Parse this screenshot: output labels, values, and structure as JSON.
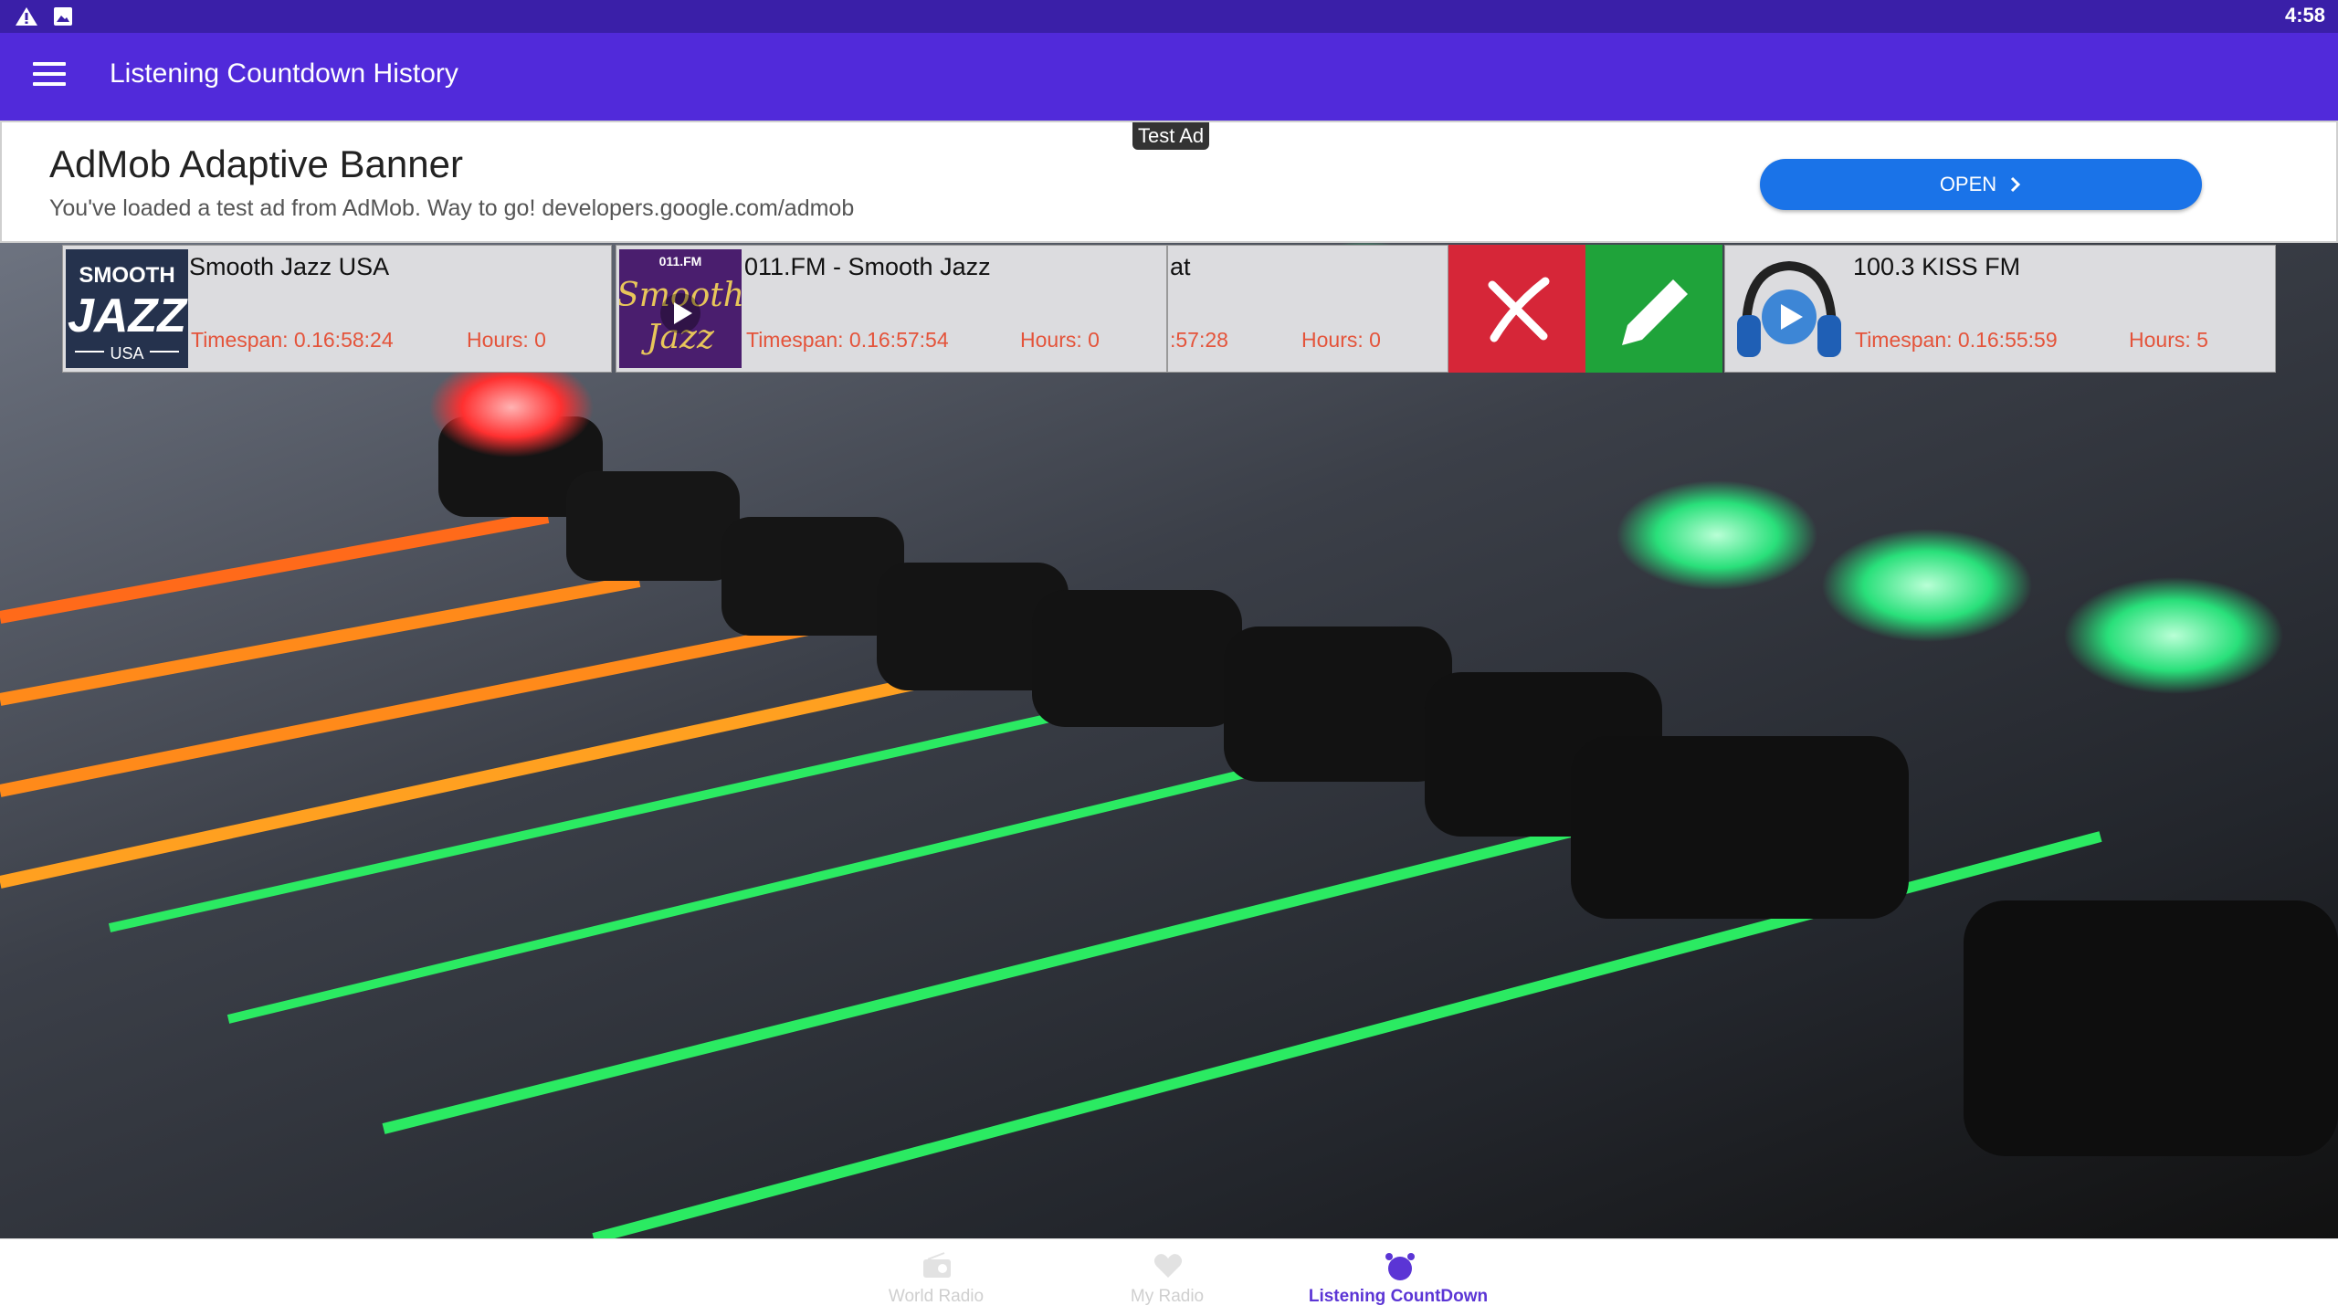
{
  "status": {
    "time": "4:58"
  },
  "appbar": {
    "title": "Listening Countdown History"
  },
  "ad": {
    "badge": "Test Ad",
    "headline": "AdMob Adaptive Banner",
    "body": "You've loaded a test ad from AdMob. Way to go! developers.google.com/admob",
    "cta": "OPEN"
  },
  "cards": [
    {
      "name": "Smooth Jazz USA",
      "timespan": "Timespan: 0.16:58:24",
      "hours": "Hours: 0"
    },
    {
      "name": "011.FM - Smooth Jazz",
      "timespan": "Timespan: 0.16:57:54",
      "hours": "Hours: 0"
    },
    {
      "name": "at",
      "timespan": ":57:28",
      "hours": "Hours: 0"
    },
    {
      "name": "100.3 KISS FM",
      "timespan": "Timespan: 0.16:55:59",
      "hours": "Hours: 5"
    }
  ],
  "thumbs": {
    "smooth_jazz_usa": {
      "top": "SMOOTH",
      "mid": "JAZZ",
      "bottom": "USA"
    },
    "fm011": {
      "top": "011.FM",
      "mid": "Smooth",
      "bottom": "Jazz"
    }
  },
  "nav": [
    {
      "label": "World Radio",
      "active": false
    },
    {
      "label": "My Radio",
      "active": false
    },
    {
      "label": "Listening CountDown",
      "active": true
    }
  ],
  "colors": {
    "appbar": "#512ada",
    "statusbar": "#3a1fa8",
    "delete": "#d62638",
    "edit": "#1fa33a",
    "accent": "#5b35d5",
    "timespan": "#e4533a"
  }
}
